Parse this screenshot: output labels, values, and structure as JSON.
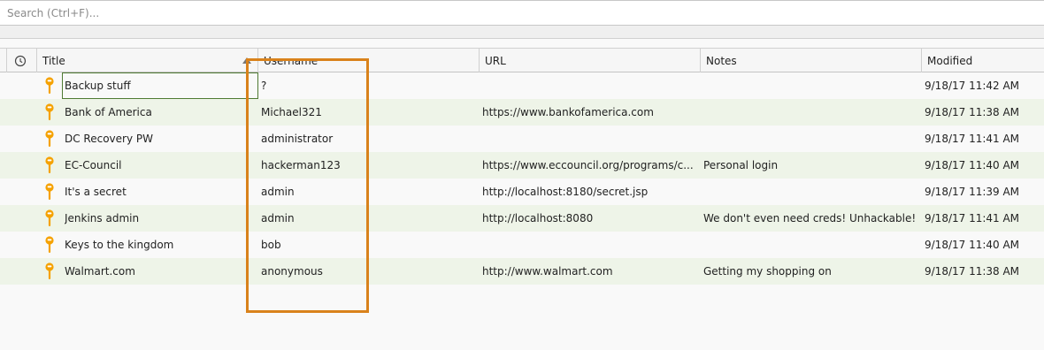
{
  "search": {
    "placeholder": "Search (Ctrl+F)..."
  },
  "columns": {
    "title": "Title",
    "username": "Username",
    "url": "URL",
    "notes": "Notes",
    "modified": "Modified"
  },
  "entries": [
    {
      "title": "Backup stuff",
      "username": "?",
      "url": "",
      "notes": "",
      "modified": "9/18/17 11:42 AM"
    },
    {
      "title": "Bank of America",
      "username": "Michael321",
      "url": "https://www.bankofamerica.com",
      "notes": "",
      "modified": "9/18/17 11:38 AM"
    },
    {
      "title": "DC Recovery PW",
      "username": "administrator",
      "url": "",
      "notes": "",
      "modified": "9/18/17 11:41 AM"
    },
    {
      "title": "EC-Council",
      "username": "hackerman123",
      "url": "https://www.eccouncil.org/programs/c...",
      "notes": "Personal login",
      "modified": "9/18/17 11:40 AM"
    },
    {
      "title": "It's a secret",
      "username": "admin",
      "url": "http://localhost:8180/secret.jsp",
      "notes": "",
      "modified": "9/18/17 11:39 AM"
    },
    {
      "title": "Jenkins admin",
      "username": "admin",
      "url": "http://localhost:8080",
      "notes": "We don't even need creds! Unhackable!",
      "modified": "9/18/17 11:41 AM"
    },
    {
      "title": "Keys to the kingdom",
      "username": "bob",
      "url": "",
      "notes": "",
      "modified": "9/18/17 11:40 AM"
    },
    {
      "title": "Walmart.com",
      "username": "anonymous",
      "url": "http://www.walmart.com",
      "notes": "Getting my shopping on",
      "modified": "9/18/17 11:38 AM"
    }
  ],
  "colors": {
    "key_icon": "#f5a100",
    "alt_row": "#eef4e8",
    "highlight": "#d9821b",
    "selection": "#4f7a33"
  },
  "icons": {
    "history_column": "clock-icon",
    "entry": "key-icon"
  }
}
